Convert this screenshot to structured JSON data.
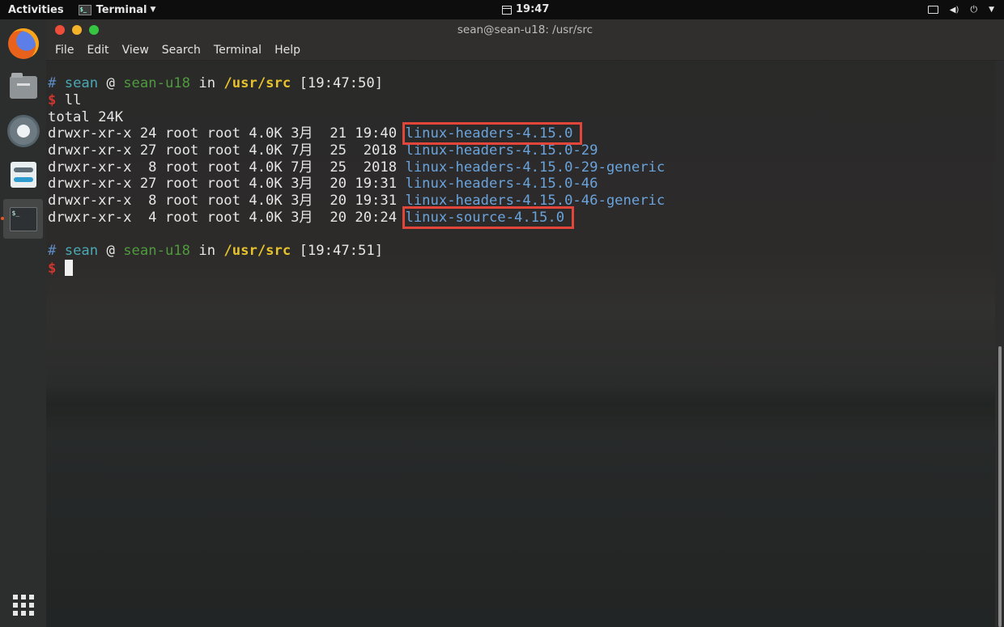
{
  "topbar": {
    "activities": "Activities",
    "app_name": "Terminal",
    "clock": "19:47"
  },
  "window": {
    "title": "sean@sean-u18: /usr/src",
    "menu": [
      "File",
      "Edit",
      "View",
      "Search",
      "Terminal",
      "Help"
    ]
  },
  "terminal": {
    "prompt1": {
      "hash": "#",
      "user": "sean",
      "at": "@",
      "host": "sean-u18",
      "in": "in",
      "path": "/usr/src",
      "time": "[19:47:50]"
    },
    "command": {
      "dollar": "$",
      "text": "ll"
    },
    "total": "total 24K",
    "listing": [
      {
        "meta": "drwxr-xr-x 24 root root 4.0K 3月  21 19:40",
        "name": "linux-headers-4.15.0",
        "highlighted": true
      },
      {
        "meta": "drwxr-xr-x 27 root root 4.0K 7月  25  2018",
        "name": "linux-headers-4.15.0-29",
        "highlighted": false
      },
      {
        "meta": "drwxr-xr-x  8 root root 4.0K 7月  25  2018",
        "name": "linux-headers-4.15.0-29-generic",
        "highlighted": false
      },
      {
        "meta": "drwxr-xr-x 27 root root 4.0K 3月  20 19:31",
        "name": "linux-headers-4.15.0-46",
        "highlighted": false
      },
      {
        "meta": "drwxr-xr-x  8 root root 4.0K 3月  20 19:31",
        "name": "linux-headers-4.15.0-46-generic",
        "highlighted": false
      },
      {
        "meta": "drwxr-xr-x  4 root root 4.0K 3月  20 20:24",
        "name": "linux-source-4.15.0",
        "highlighted": true
      }
    ],
    "prompt2": {
      "hash": "#",
      "user": "sean",
      "at": "@",
      "host": "sean-u18",
      "in": "in",
      "path": "/usr/src",
      "time": "[19:47:51]"
    },
    "prompt2_dollar": "$"
  },
  "colors": {
    "highlight_box": "#e2463a",
    "directory": "#6aa3dc",
    "path": "#e6c22d",
    "dollar": "#d0362e"
  },
  "dock": {
    "icons": [
      "firefox-icon",
      "files-icon",
      "settings-icon",
      "tweaks-icon",
      "terminal-icon",
      "show-apps-icon"
    ]
  }
}
